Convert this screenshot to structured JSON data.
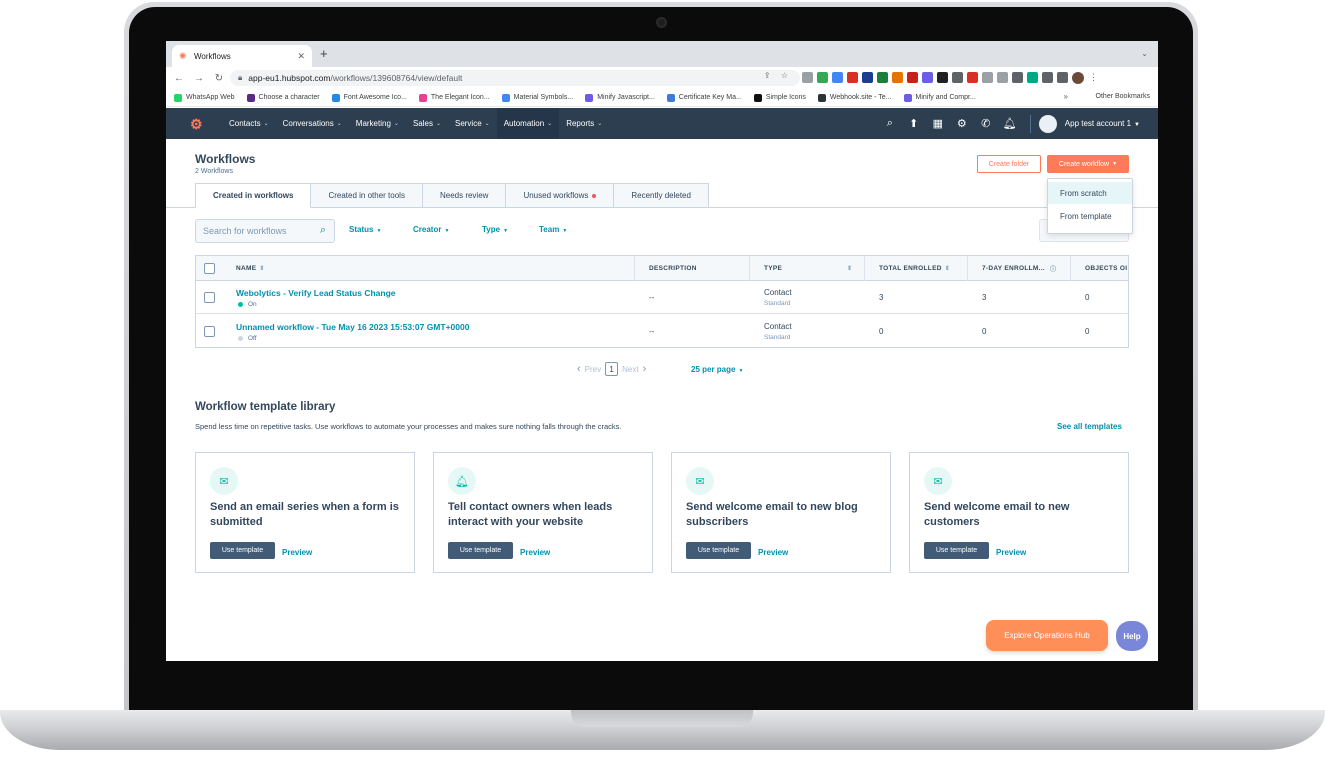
{
  "browser": {
    "tab_title": "Workflows",
    "url_host": "app-eu1.hubspot.com",
    "url_path": "/workflows/139608764/view/default",
    "bookmarks": [
      {
        "label": "WhatsApp Web",
        "color": "#25d366"
      },
      {
        "label": "Choose a character",
        "color": "#5b2a86"
      },
      {
        "label": "Font Awesome Ico...",
        "color": "#228ae6"
      },
      {
        "label": "The Elegant Icon...",
        "color": "#e84393"
      },
      {
        "label": "Material Symbols...",
        "color": "#4285f4"
      },
      {
        "label": "Minify Javascript...",
        "color": "#6c5ce7"
      },
      {
        "label": "Certificate Key Ma...",
        "color": "#3d7bd9"
      },
      {
        "label": "Simple Icons",
        "color": "#111111"
      },
      {
        "label": "Webhook.site - Te...",
        "color": "#2d3436"
      },
      {
        "label": "Minify and Compr...",
        "color": "#6c5ce7"
      }
    ],
    "other_bookmarks": "Other Bookmarks"
  },
  "nav": {
    "items": [
      "Contacts",
      "Conversations",
      "Marketing",
      "Sales",
      "Service",
      "Automation",
      "Reports"
    ],
    "active": "Automation",
    "account": "App test account 1"
  },
  "header": {
    "title": "Workflows",
    "subtitle": "2 Workflows",
    "create_folder": "Create folder",
    "create_workflow": "Create workflow",
    "dropdown": [
      "From scratch",
      "From template"
    ]
  },
  "tabs": [
    "Created in workflows",
    "Created in other tools",
    "Needs review",
    "Unused workflows",
    "Recently deleted"
  ],
  "filters": {
    "search_placeholder": "Search for workflows",
    "items": [
      "Status",
      "Creator",
      "Type",
      "Team"
    ]
  },
  "table": {
    "columns": [
      "NAME",
      "DESCRIPTION",
      "TYPE",
      "TOTAL ENROLLED",
      "7-DAY ENROLLM...",
      "OBJECTS OI"
    ],
    "rows": [
      {
        "name": "Webolytics - Verify Lead Status Change",
        "status": "On",
        "status_color": "#00bda5",
        "description": "--",
        "type": "Contact",
        "type_sub": "Standard",
        "total": "3",
        "seven_day": "3",
        "objects": "0"
      },
      {
        "name": "Unnamed workflow - Tue May 16 2023 15:53:07 GMT+0000",
        "status": "Off",
        "status_color": "#cbd6e2",
        "description": "--",
        "type": "Contact",
        "type_sub": "Standard",
        "total": "0",
        "seven_day": "0",
        "objects": "0"
      }
    ]
  },
  "pagination": {
    "prev": "Prev",
    "page": "1",
    "next": "Next",
    "per_page": "25 per page"
  },
  "library": {
    "title": "Workflow template library",
    "description": "Spend less time on repetitive tasks. Use workflows to automate your processes and makes sure nothing falls through the cracks.",
    "see_all": "See all templates",
    "use_label": "Use template",
    "preview_label": "Preview",
    "cards": [
      {
        "title": "Send an email series when a form is submitted",
        "icon": "envelope-icon"
      },
      {
        "title": "Tell contact owners when leads interact with your website",
        "icon": "bell-icon"
      },
      {
        "title": "Send welcome email to new blog subscribers",
        "icon": "envelope-icon"
      },
      {
        "title": "Send welcome email to new customers",
        "icon": "envelope-icon"
      }
    ]
  },
  "footer": {
    "explore": "Explore Operations Hub",
    "help": "Help"
  }
}
